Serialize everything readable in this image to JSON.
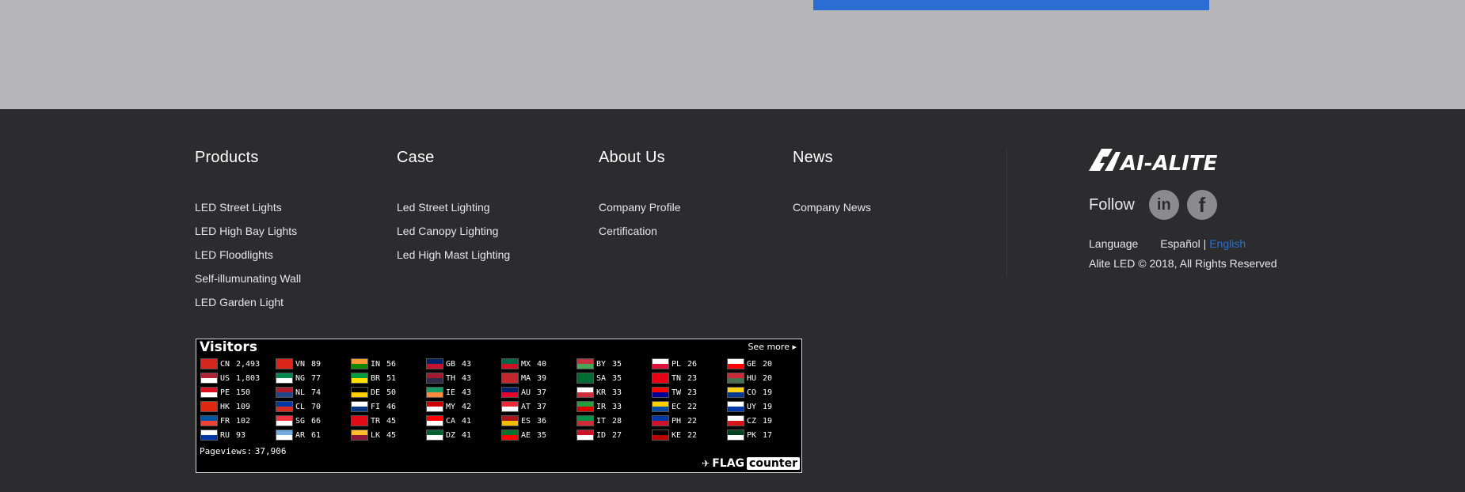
{
  "columns": [
    {
      "title": "Products",
      "items": [
        "LED Street Lights",
        "LED High Bay Lights",
        "LED Floodlights",
        "Self-illumunating Wall",
        "LED Garden Light"
      ]
    },
    {
      "title": "Case",
      "items": [
        "Led Street Lighting",
        "Led Canopy Lighting",
        "Led High Mast Lighting"
      ]
    },
    {
      "title": "About Us",
      "items": [
        "Company Profile",
        "Certification"
      ]
    },
    {
      "title": "News",
      "items": [
        "Company News"
      ]
    }
  ],
  "brand": {
    "logo_text": "AI-ALITE",
    "follow_label": "Follow",
    "social": [
      {
        "name": "linkedin-icon",
        "glyph": "in"
      },
      {
        "name": "facebook-icon",
        "glyph": "f"
      }
    ],
    "language_label": "Language",
    "language_options": [
      "Español",
      "English"
    ],
    "language_separator": " | ",
    "active_language": "English",
    "copyright": "Alite LED © 2018, All Rights Reserved"
  },
  "colors": {
    "accent": "#2a6ed4",
    "footer_bg": "#2c2c2e",
    "top_bg": "#b7b6bb"
  },
  "flag_counter": {
    "title": "Visitors",
    "see_more": "See more",
    "pageviews_label": "Pageviews:",
    "pageviews": "37,906",
    "logo_a": "FLAG",
    "logo_b": "counter",
    "columns": [
      [
        {
          "code": "CN",
          "count": "2,493",
          "colors": [
            "#d7261e",
            "#d7261e"
          ]
        },
        {
          "code": "US",
          "count": "1,803",
          "colors": [
            "#b22234",
            "#ffffff"
          ]
        },
        {
          "code": "PE",
          "count": "150",
          "colors": [
            "#d91023",
            "#ffffff"
          ]
        },
        {
          "code": "HK",
          "count": "109",
          "colors": [
            "#de2910",
            "#de2910"
          ]
        },
        {
          "code": "FR",
          "count": "102",
          "colors": [
            "#0055a4",
            "#ef4135"
          ]
        },
        {
          "code": "RU",
          "count": "93",
          "colors": [
            "#ffffff",
            "#0039a6"
          ]
        }
      ],
      [
        {
          "code": "VN",
          "count": "89",
          "colors": [
            "#da251d",
            "#da251d"
          ]
        },
        {
          "code": "NG",
          "count": "77",
          "colors": [
            "#008751",
            "#ffffff"
          ]
        },
        {
          "code": "NL",
          "count": "74",
          "colors": [
            "#ae1c28",
            "#21468b"
          ]
        },
        {
          "code": "CL",
          "count": "70",
          "colors": [
            "#0039a6",
            "#d52b1e"
          ]
        },
        {
          "code": "SG",
          "count": "66",
          "colors": [
            "#ef3340",
            "#ffffff"
          ]
        },
        {
          "code": "AR",
          "count": "61",
          "colors": [
            "#74acdf",
            "#ffffff"
          ]
        }
      ],
      [
        {
          "code": "IN",
          "count": "56",
          "colors": [
            "#ff9933",
            "#138808"
          ]
        },
        {
          "code": "BR",
          "count": "51",
          "colors": [
            "#009c3b",
            "#ffdf00"
          ]
        },
        {
          "code": "DE",
          "count": "50",
          "colors": [
            "#000000",
            "#ffce00"
          ]
        },
        {
          "code": "FI",
          "count": "46",
          "colors": [
            "#ffffff",
            "#003580"
          ]
        },
        {
          "code": "TR",
          "count": "45",
          "colors": [
            "#e30a17",
            "#e30a17"
          ]
        },
        {
          "code": "LK",
          "count": "45",
          "colors": [
            "#ffbe29",
            "#8d153a"
          ]
        }
      ],
      [
        {
          "code": "GB",
          "count": "43",
          "colors": [
            "#012169",
            "#c8102e"
          ]
        },
        {
          "code": "TH",
          "count": "43",
          "colors": [
            "#a51931",
            "#2d2a4a"
          ]
        },
        {
          "code": "IE",
          "count": "43",
          "colors": [
            "#169b62",
            "#ff883e"
          ]
        },
        {
          "code": "MY",
          "count": "42",
          "colors": [
            "#cc0001",
            "#ffffff"
          ]
        },
        {
          "code": "CA",
          "count": "41",
          "colors": [
            "#ff0000",
            "#ffffff"
          ]
        },
        {
          "code": "DZ",
          "count": "41",
          "colors": [
            "#006233",
            "#ffffff"
          ]
        }
      ],
      [
        {
          "code": "MX",
          "count": "40",
          "colors": [
            "#006847",
            "#ce1126"
          ]
        },
        {
          "code": "MA",
          "count": "39",
          "colors": [
            "#c1272d",
            "#c1272d"
          ]
        },
        {
          "code": "AU",
          "count": "37",
          "colors": [
            "#012169",
            "#e4002b"
          ]
        },
        {
          "code": "AT",
          "count": "37",
          "colors": [
            "#ed2939",
            "#ffffff"
          ]
        },
        {
          "code": "ES",
          "count": "36",
          "colors": [
            "#aa151b",
            "#f1bf00"
          ]
        },
        {
          "code": "AE",
          "count": "35",
          "colors": [
            "#00732f",
            "#ff0000"
          ]
        }
      ],
      [
        {
          "code": "BY",
          "count": "35",
          "colors": [
            "#c8313e",
            "#4aa657"
          ]
        },
        {
          "code": "SA",
          "count": "35",
          "colors": [
            "#006c35",
            "#006c35"
          ]
        },
        {
          "code": "KR",
          "count": "33",
          "colors": [
            "#ffffff",
            "#cd2e3a"
          ]
        },
        {
          "code": "IR",
          "count": "33",
          "colors": [
            "#239f40",
            "#da0000"
          ]
        },
        {
          "code": "IT",
          "count": "28",
          "colors": [
            "#009246",
            "#ce2b37"
          ]
        },
        {
          "code": "ID",
          "count": "27",
          "colors": [
            "#ce1126",
            "#ffffff"
          ]
        }
      ],
      [
        {
          "code": "PL",
          "count": "26",
          "colors": [
            "#ffffff",
            "#dc143c"
          ]
        },
        {
          "code": "TN",
          "count": "23",
          "colors": [
            "#e70013",
            "#e70013"
          ]
        },
        {
          "code": "TW",
          "count": "23",
          "colors": [
            "#fe0000",
            "#000095"
          ]
        },
        {
          "code": "EC",
          "count": "22",
          "colors": [
            "#ffd100",
            "#034ea2"
          ]
        },
        {
          "code": "PH",
          "count": "22",
          "colors": [
            "#0038a8",
            "#ce1126"
          ]
        },
        {
          "code": "KE",
          "count": "22",
          "colors": [
            "#000000",
            "#bb0000"
          ]
        }
      ],
      [
        {
          "code": "GE",
          "count": "20",
          "colors": [
            "#ffffff",
            "#ff0000"
          ]
        },
        {
          "code": "HU",
          "count": "20",
          "colors": [
            "#ce2939",
            "#477050"
          ]
        },
        {
          "code": "CO",
          "count": "19",
          "colors": [
            "#fcd116",
            "#003893"
          ]
        },
        {
          "code": "UY",
          "count": "19",
          "colors": [
            "#ffffff",
            "#0038a8"
          ]
        },
        {
          "code": "CZ",
          "count": "19",
          "colors": [
            "#ffffff",
            "#d7141a"
          ]
        },
        {
          "code": "PK",
          "count": "17",
          "colors": [
            "#01411c",
            "#ffffff"
          ]
        }
      ]
    ]
  }
}
